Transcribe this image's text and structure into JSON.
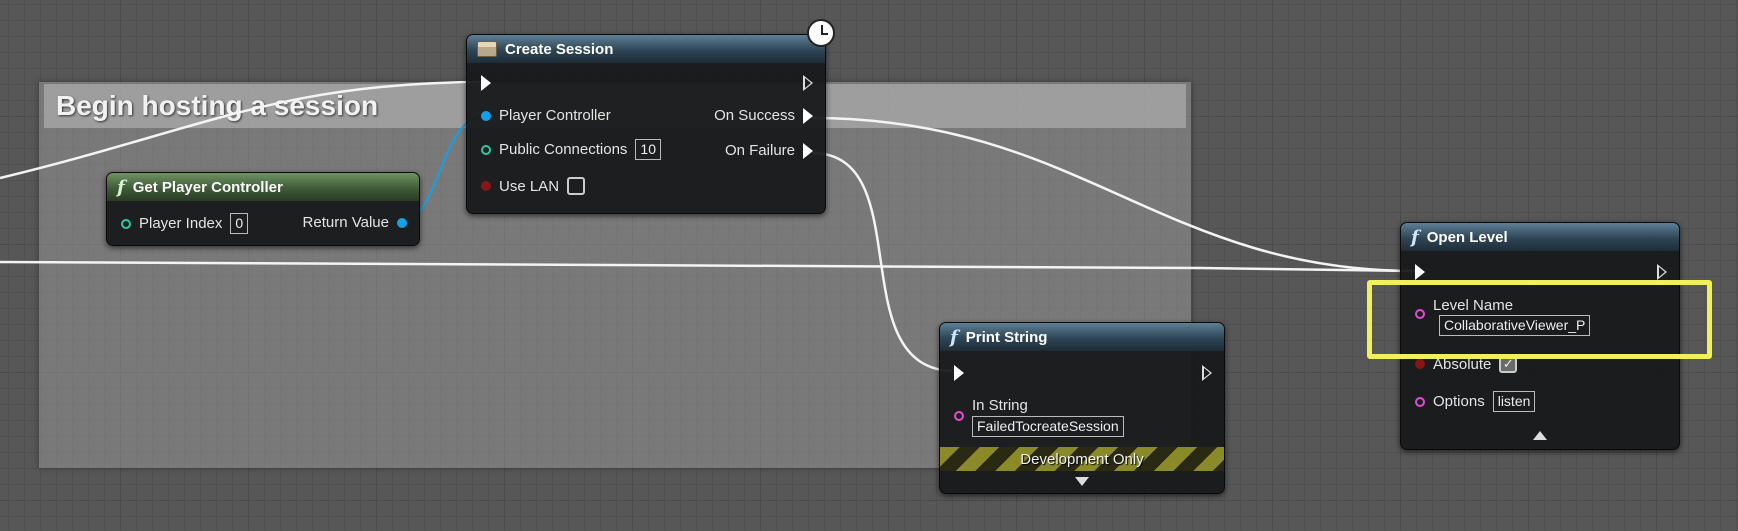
{
  "comment_box": {
    "title": "Begin hosting a session"
  },
  "nodes": {
    "create_session": {
      "title": "Create Session",
      "inputs": {
        "player_controller": "Player Controller",
        "public_connections": "Public Connections",
        "public_connections_value": "10",
        "use_lan": "Use LAN"
      },
      "outputs": {
        "on_success": "On Success",
        "on_failure": "On Failure"
      }
    },
    "get_player_controller": {
      "title": "Get Player Controller",
      "player_index": "Player Index",
      "player_index_value": "0",
      "return_value": "Return Value"
    },
    "print_string": {
      "title": "Print String",
      "in_string": "In String",
      "in_string_value": "FailedTocreateSession",
      "dev_only": "Development Only"
    },
    "open_level": {
      "title": "Open Level",
      "level_name": "Level Name",
      "level_name_value": "CollaborativeViewer_P",
      "absolute": "Absolute",
      "options": "Options",
      "options_value": "listen"
    }
  },
  "colors": {
    "highlight": "#f2f05a",
    "object_pin": "#14a0e8",
    "int_pin": "#2ec9a0",
    "bool_pin": "#8a1515",
    "string_pin": "#e44bd6"
  }
}
